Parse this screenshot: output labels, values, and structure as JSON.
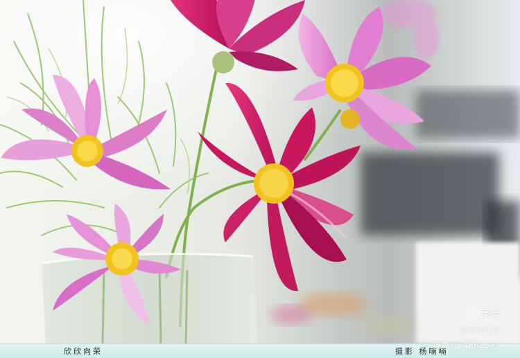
{
  "caption": {
    "title": "欣欣向荣",
    "credit": "摄影 杨喃喃"
  },
  "watermark": {
    "brand": "美篇",
    "handle": "@燕语喃喃",
    "id": "美篇号: 4868531"
  },
  "colors": {
    "magenta_petal": "#c81a66",
    "pink_petal": "#e38ad0",
    "flower_center": "#f2c21f",
    "foliage": "#8fc160",
    "caption_bar": "#d7efec"
  }
}
